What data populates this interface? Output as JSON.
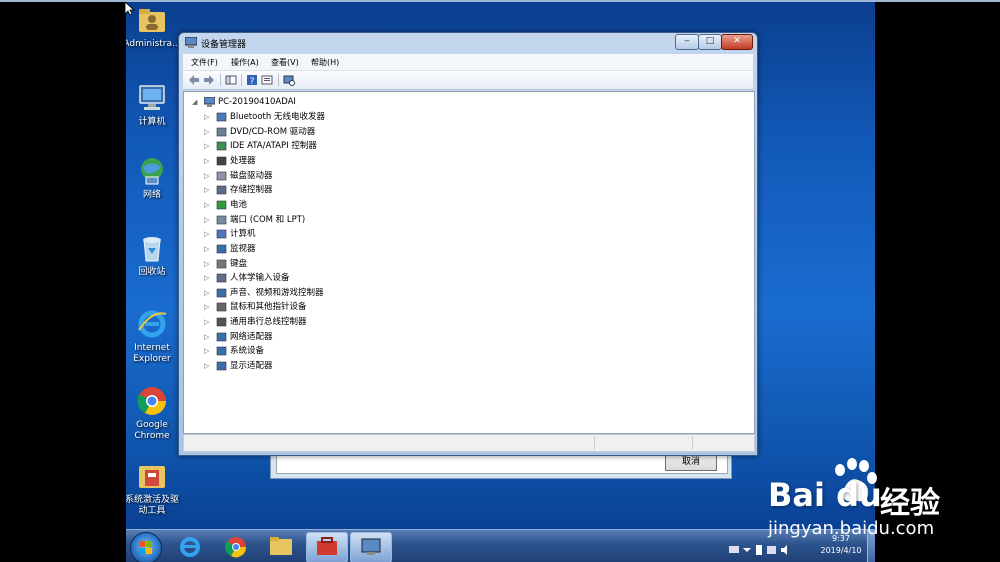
{
  "desktop": {
    "icons": [
      {
        "label": "Administra...",
        "icon": "folder-user-icon"
      },
      {
        "label": "计算机",
        "icon": "computer-icon"
      },
      {
        "label": "网络",
        "icon": "network-icon"
      },
      {
        "label": "回收站",
        "icon": "recycle-bin-icon"
      },
      {
        "label": "Internet Explorer",
        "icon": "internet-explorer-icon"
      },
      {
        "label": "Google Chrome",
        "icon": "chrome-icon"
      },
      {
        "label": "系统激活及驱动工具",
        "icon": "folder-tools-icon"
      }
    ]
  },
  "background_dialog": {
    "cancel_label": "取消"
  },
  "window": {
    "title": "设备管理器",
    "menu": [
      "文件(F)",
      "操作(A)",
      "查看(V)",
      "帮助(H)"
    ],
    "tree_root": "PC-20190410ADAI",
    "tree_items": [
      {
        "label": "Bluetooth 无线电收发器",
        "icon": "bluetooth-icon"
      },
      {
        "label": "DVD/CD-ROM 驱动器",
        "icon": "dvd-drive-icon"
      },
      {
        "label": "IDE ATA/ATAPI 控制器",
        "icon": "ide-controller-icon"
      },
      {
        "label": "处理器",
        "icon": "processor-icon"
      },
      {
        "label": "磁盘驱动器",
        "icon": "disk-drive-icon"
      },
      {
        "label": "存储控制器",
        "icon": "storage-controller-icon"
      },
      {
        "label": "电池",
        "icon": "battery-icon"
      },
      {
        "label": "端口 (COM 和 LPT)",
        "icon": "port-icon"
      },
      {
        "label": "计算机",
        "icon": "computer-icon"
      },
      {
        "label": "监视器",
        "icon": "monitor-icon"
      },
      {
        "label": "键盘",
        "icon": "keyboard-icon"
      },
      {
        "label": "人体学输入设备",
        "icon": "hid-icon"
      },
      {
        "label": "声音、视频和游戏控制器",
        "icon": "sound-icon"
      },
      {
        "label": "鼠标和其他指针设备",
        "icon": "mouse-icon"
      },
      {
        "label": "通用串行总线控制器",
        "icon": "usb-icon"
      },
      {
        "label": "网络适配器",
        "icon": "network-adapter-icon"
      },
      {
        "label": "系统设备",
        "icon": "system-device-icon"
      },
      {
        "label": "显示适配器",
        "icon": "display-adapter-icon"
      }
    ]
  },
  "taskbar": {
    "time": "9:37",
    "date": "2019/4/10"
  },
  "watermark": {
    "brand": "Bai du",
    "product": "经验",
    "url": "jingyan.baidu.com"
  },
  "colors": {
    "desktop": "#1a6cd0",
    "taskbar": "#2f558f"
  }
}
